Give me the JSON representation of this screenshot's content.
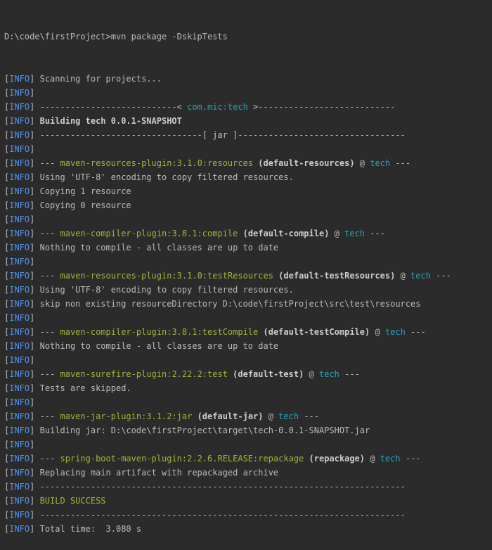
{
  "colors": {
    "background": "#2b2b2b",
    "text": "#bbbbbb",
    "info": "#5394ec",
    "artifact": "#2aa3b8",
    "plugin": "#a8b13c",
    "success": "#a8b13c"
  },
  "prompt": "D:\\code\\firstProject>mvn package -DskipTests",
  "info_tag": "INFO",
  "lines": [
    {
      "segs": [
        {
          "t": "Scanning for projects...",
          "c": "plain"
        }
      ]
    },
    {
      "segs": []
    },
    {
      "segs": [
        {
          "t": "---------------------------< ",
          "c": "plain"
        },
        {
          "t": "com.mic:tech",
          "c": "cyan"
        },
        {
          "t": " >---------------------------",
          "c": "plain"
        }
      ]
    },
    {
      "segs": [
        {
          "t": "Building tech 0.0.1-SNAPSHOT",
          "c": "bold"
        }
      ]
    },
    {
      "segs": [
        {
          "t": "--------------------------------[ jar ]---------------------------------",
          "c": "plain"
        }
      ]
    },
    {
      "segs": []
    },
    {
      "segs": [
        {
          "t": "--- ",
          "c": "plain"
        },
        {
          "t": "maven-resources-plugin:3.1.0:resources",
          "c": "green"
        },
        {
          "t": " ",
          "c": "plain"
        },
        {
          "t": "(default-resources)",
          "c": "bold"
        },
        {
          "t": " @ ",
          "c": "plain"
        },
        {
          "t": "tech",
          "c": "cyan"
        },
        {
          "t": " ---",
          "c": "plain"
        }
      ]
    },
    {
      "segs": [
        {
          "t": "Using 'UTF-8' encoding to copy filtered resources.",
          "c": "plain"
        }
      ]
    },
    {
      "segs": [
        {
          "t": "Copying 1 resource",
          "c": "plain"
        }
      ]
    },
    {
      "segs": [
        {
          "t": "Copying 0 resource",
          "c": "plain"
        }
      ]
    },
    {
      "segs": []
    },
    {
      "segs": [
        {
          "t": "--- ",
          "c": "plain"
        },
        {
          "t": "maven-compiler-plugin:3.8.1:compile",
          "c": "green"
        },
        {
          "t": " ",
          "c": "plain"
        },
        {
          "t": "(default-compile)",
          "c": "bold"
        },
        {
          "t": " @ ",
          "c": "plain"
        },
        {
          "t": "tech",
          "c": "cyan"
        },
        {
          "t": " ---",
          "c": "plain"
        }
      ]
    },
    {
      "segs": [
        {
          "t": "Nothing to compile - all classes are up to date",
          "c": "plain"
        }
      ]
    },
    {
      "segs": []
    },
    {
      "segs": [
        {
          "t": "--- ",
          "c": "plain"
        },
        {
          "t": "maven-resources-plugin:3.1.0:testResources",
          "c": "green"
        },
        {
          "t": " ",
          "c": "plain"
        },
        {
          "t": "(default-testResources)",
          "c": "bold"
        },
        {
          "t": " @ ",
          "c": "plain"
        },
        {
          "t": "tech",
          "c": "cyan"
        },
        {
          "t": " ---",
          "c": "plain"
        }
      ]
    },
    {
      "segs": [
        {
          "t": "Using 'UTF-8' encoding to copy filtered resources.",
          "c": "plain"
        }
      ]
    },
    {
      "segs": [
        {
          "t": "skip non existing resourceDirectory D:\\code\\firstProject\\src\\test\\resources",
          "c": "plain"
        }
      ]
    },
    {
      "segs": []
    },
    {
      "segs": [
        {
          "t": "--- ",
          "c": "plain"
        },
        {
          "t": "maven-compiler-plugin:3.8.1:testCompile",
          "c": "green"
        },
        {
          "t": " ",
          "c": "plain"
        },
        {
          "t": "(default-testCompile)",
          "c": "bold"
        },
        {
          "t": " @ ",
          "c": "plain"
        },
        {
          "t": "tech",
          "c": "cyan"
        },
        {
          "t": " ---",
          "c": "plain"
        }
      ]
    },
    {
      "segs": [
        {
          "t": "Nothing to compile - all classes are up to date",
          "c": "plain"
        }
      ]
    },
    {
      "segs": []
    },
    {
      "segs": [
        {
          "t": "--- ",
          "c": "plain"
        },
        {
          "t": "maven-surefire-plugin:2.22.2:test",
          "c": "green"
        },
        {
          "t": " ",
          "c": "plain"
        },
        {
          "t": "(default-test)",
          "c": "bold"
        },
        {
          "t": " @ ",
          "c": "plain"
        },
        {
          "t": "tech",
          "c": "cyan"
        },
        {
          "t": " ---",
          "c": "plain"
        }
      ]
    },
    {
      "segs": [
        {
          "t": "Tests are skipped.",
          "c": "plain"
        }
      ]
    },
    {
      "segs": []
    },
    {
      "segs": [
        {
          "t": "--- ",
          "c": "plain"
        },
        {
          "t": "maven-jar-plugin:3.1.2:jar",
          "c": "green"
        },
        {
          "t": " ",
          "c": "plain"
        },
        {
          "t": "(default-jar)",
          "c": "bold"
        },
        {
          "t": " @ ",
          "c": "plain"
        },
        {
          "t": "tech",
          "c": "cyan"
        },
        {
          "t": " ---",
          "c": "plain"
        }
      ]
    },
    {
      "segs": [
        {
          "t": "Building jar: D:\\code\\firstProject\\target\\tech-0.0.1-SNAPSHOT.jar",
          "c": "plain"
        }
      ]
    },
    {
      "segs": []
    },
    {
      "segs": [
        {
          "t": "--- ",
          "c": "plain"
        },
        {
          "t": "spring-boot-maven-plugin:2.2.6.RELEASE:repackage",
          "c": "green"
        },
        {
          "t": " ",
          "c": "plain"
        },
        {
          "t": "(repackage)",
          "c": "bold"
        },
        {
          "t": " @ ",
          "c": "plain"
        },
        {
          "t": "tech",
          "c": "cyan"
        },
        {
          "t": " ---",
          "c": "plain"
        }
      ]
    },
    {
      "segs": [
        {
          "t": "Replacing main artifact with repackaged archive",
          "c": "plain"
        }
      ]
    },
    {
      "segs": [
        {
          "t": "------------------------------------------------------------------------",
          "c": "plain"
        }
      ]
    },
    {
      "segs": [
        {
          "t": "BUILD SUCCESS",
          "c": "success"
        }
      ]
    },
    {
      "segs": [
        {
          "t": "------------------------------------------------------------------------",
          "c": "plain"
        }
      ]
    },
    {
      "segs": [
        {
          "t": "Total time:  3.080 s",
          "c": "plain"
        }
      ]
    }
  ]
}
